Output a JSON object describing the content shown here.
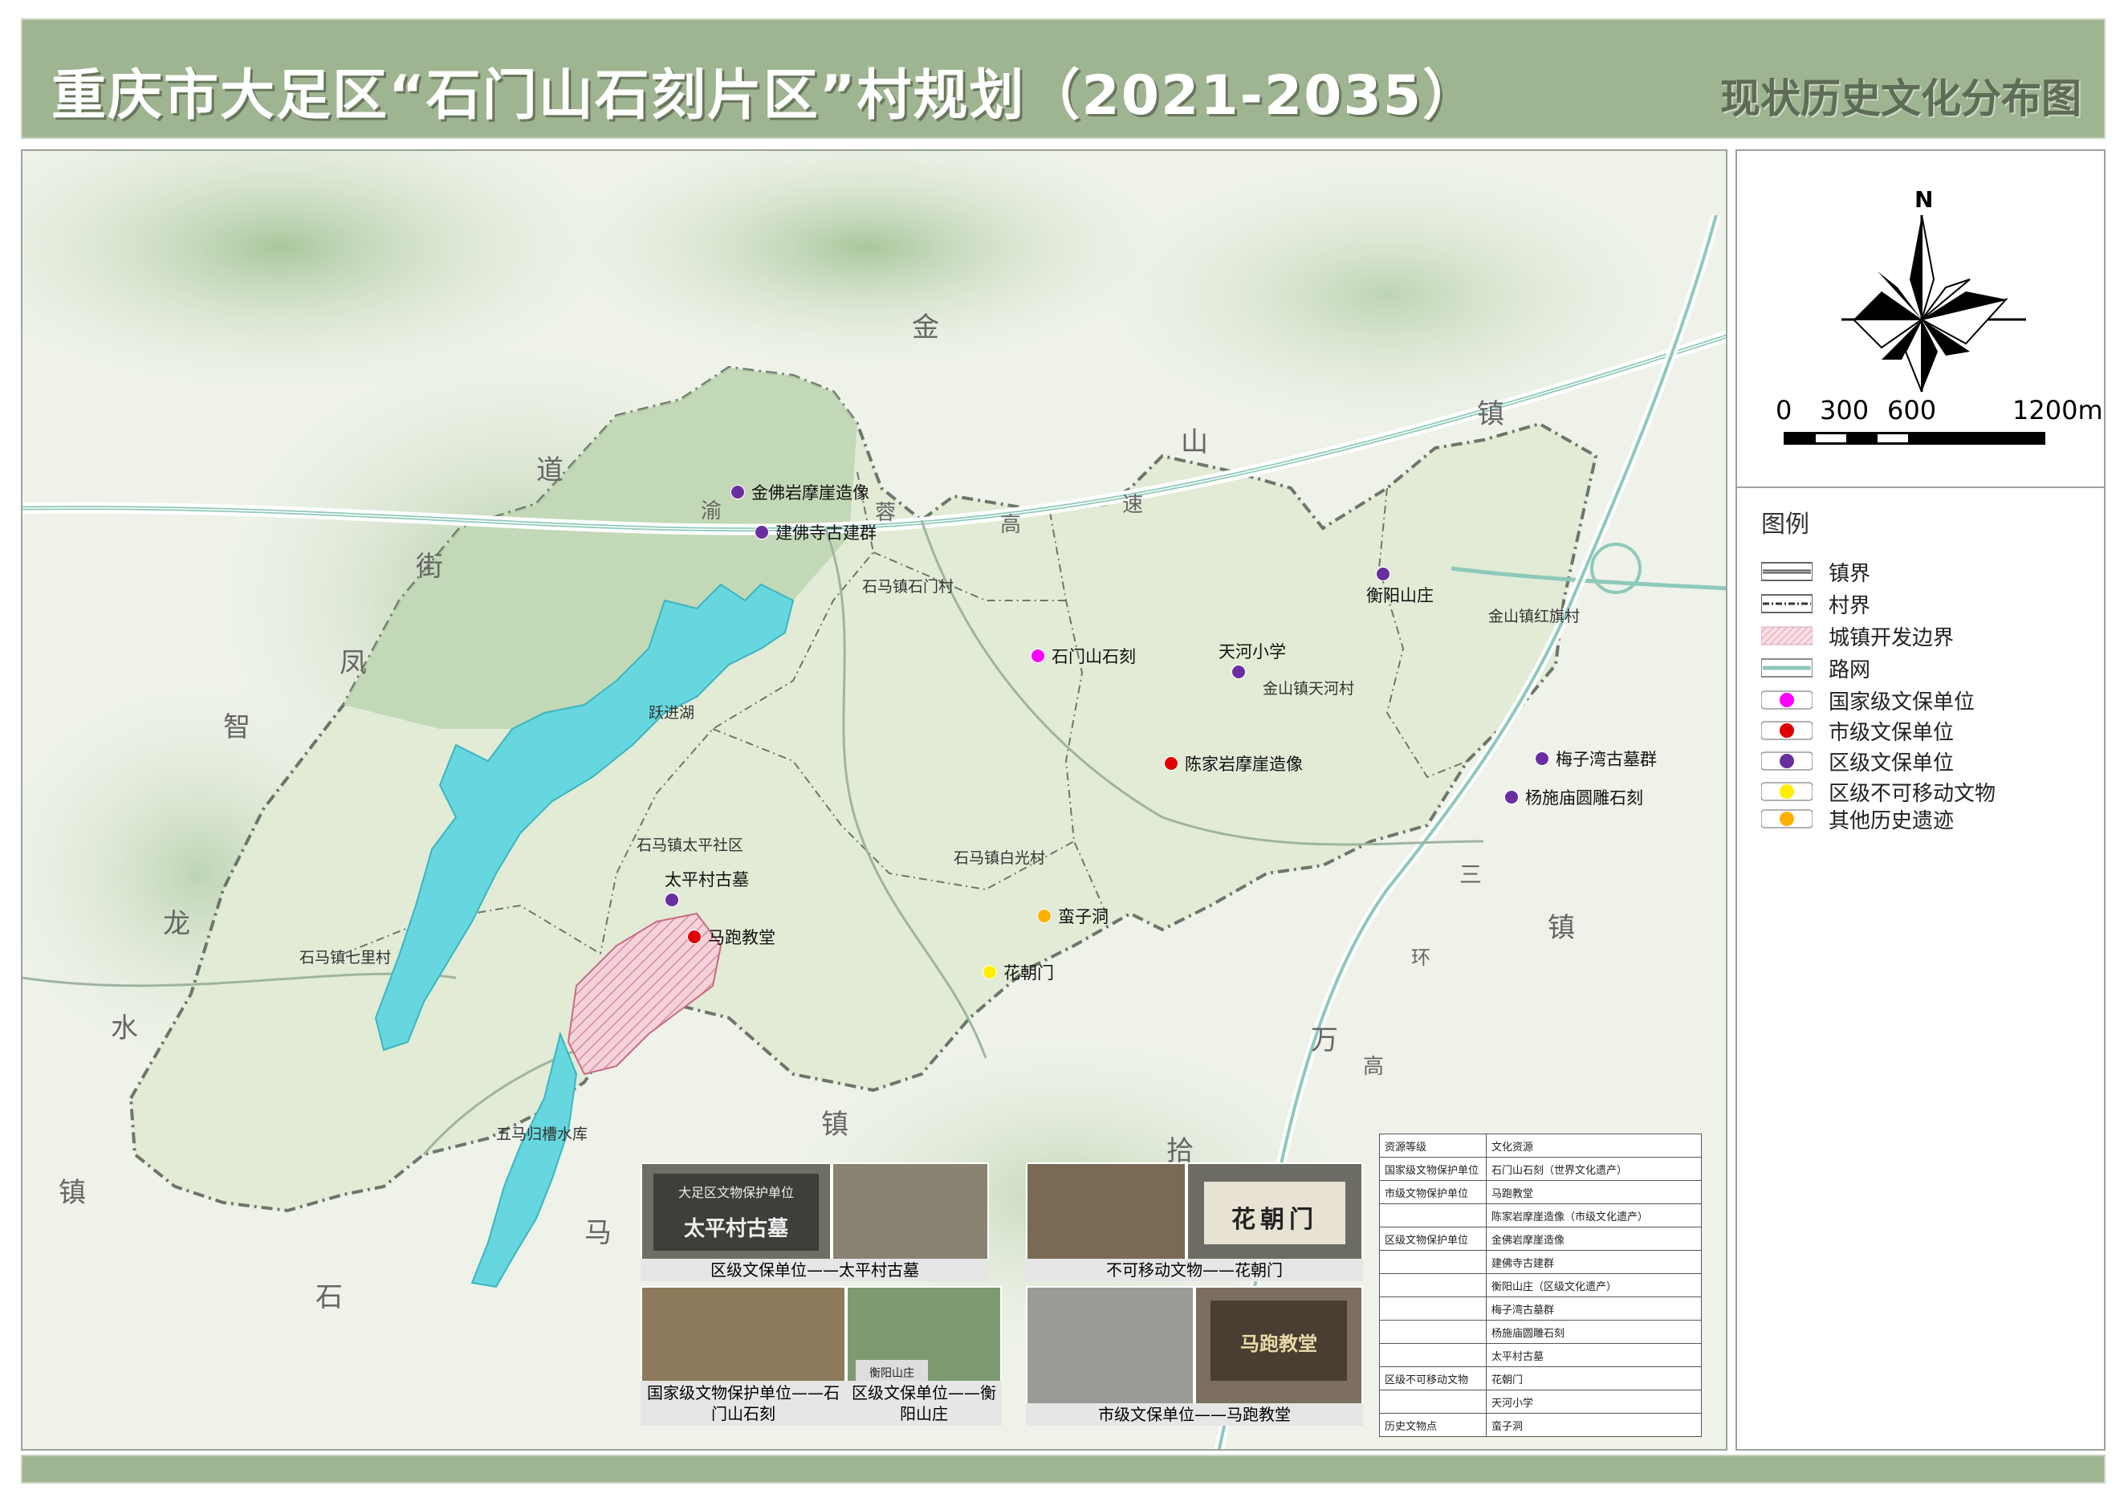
{
  "header": {
    "title": "重庆市大足区“石门山石刻片区”村规划（2021-2035）",
    "subtitle": "现状历史文化分布图"
  },
  "compass": {
    "north_label": "N"
  },
  "scalebar": {
    "ticks": [
      "0",
      "300",
      "600",
      "1200m"
    ]
  },
  "legend": {
    "title": "图例",
    "items": [
      {
        "label": "镇界",
        "type": "line"
      },
      {
        "label": "村界",
        "type": "dashline"
      },
      {
        "label": "城镇开发边界",
        "type": "hatch",
        "color": "#f2c4cf"
      },
      {
        "label": "路网",
        "type": "road",
        "color": "#8ec9bb"
      },
      {
        "label": "国家级文保单位",
        "type": "dot",
        "color": "#ff00ff"
      },
      {
        "label": "市级文保单位",
        "type": "dot",
        "color": "#e00000"
      },
      {
        "label": "区级文保单位",
        "type": "dot",
        "color": "#6a2ea0"
      },
      {
        "label": "区级不可移动文物",
        "type": "dot",
        "color": "#ffee00"
      },
      {
        "label": "其他历史遗迹",
        "type": "dot",
        "color": "#ffb000"
      }
    ]
  },
  "map": {
    "place_labels": [
      "金",
      "山",
      "镇",
      "道",
      "街",
      "凤",
      "智",
      "龙",
      "水",
      "镇",
      "石",
      "马",
      "镇",
      "拾",
      "万",
      "高",
      "三",
      "镇",
      "环",
      "速",
      "渝",
      "蓉",
      "高",
      "速"
    ],
    "villages": [
      "石马镇石门村",
      "跃进湖",
      "金山镇红旗村",
      "金山镇天河村",
      "石马镇太平社区",
      "石马镇白光村",
      "石马镇七里村",
      "五马归槽水库"
    ],
    "sites": [
      {
        "label": "金佛岩摩崖造像",
        "color": "#6a2ea0"
      },
      {
        "label": "建佛寺古建群",
        "color": "#6a2ea0"
      },
      {
        "label": "衡阳山庄",
        "color": "#6a2ea0"
      },
      {
        "label": "天河小学",
        "color": "#6a2ea0"
      },
      {
        "label": "石门山石刻",
        "color": "#ff00ff"
      },
      {
        "label": "陈家岩摩崖造像",
        "color": "#e00000"
      },
      {
        "label": "梅子湾古墓群",
        "color": "#6a2ea0"
      },
      {
        "label": "杨施庙圆雕石刻",
        "color": "#6a2ea0"
      },
      {
        "label": "太平村古墓",
        "color": "#6a2ea0"
      },
      {
        "label": "马跑教堂",
        "color": "#e00000"
      },
      {
        "label": "蛮子洞",
        "color": "#ffb000"
      },
      {
        "label": "花朝门",
        "color": "#ffee00"
      }
    ]
  },
  "photos": [
    {
      "caption": "区级文保单位——太平村古墓",
      "plaque_top": "大足区文物保护单位",
      "plaque_main": "太平村古墓"
    },
    {
      "caption": "不可移动文物——花朝门",
      "plaque_main": "花朝门"
    },
    {
      "caption": "国家级文物保护单位——石门山石刻"
    },
    {
      "caption": "区级文保单位——衡阳山庄",
      "plaque_main": "衡阳山庄"
    },
    {
      "caption": "市级文保单位——马跑教堂",
      "plaque_main": "马跑教堂"
    }
  ],
  "resource_table": {
    "header": [
      "资源等级",
      "文化资源"
    ],
    "rows": [
      [
        "国家级文物保护单位",
        "石门山石刻（世界文化遗产）"
      ],
      [
        "市级文物保护单位",
        "马跑教堂"
      ],
      [
        "",
        "陈家岩摩崖造像（市级文化遗产）"
      ],
      [
        "区级文物保护单位",
        "金佛岩摩崖造像"
      ],
      [
        "",
        "建佛寺古建群"
      ],
      [
        "",
        "衡阳山庄（区级文化遗产）"
      ],
      [
        "",
        "梅子湾古墓群"
      ],
      [
        "",
        "杨施庙圆雕石刻"
      ],
      [
        "",
        "太平村古墓"
      ],
      [
        "区级不可移动文物",
        "花朝门"
      ],
      [
        "",
        "天河小学"
      ],
      [
        "历史文物点",
        "蛮子洞"
      ]
    ]
  }
}
